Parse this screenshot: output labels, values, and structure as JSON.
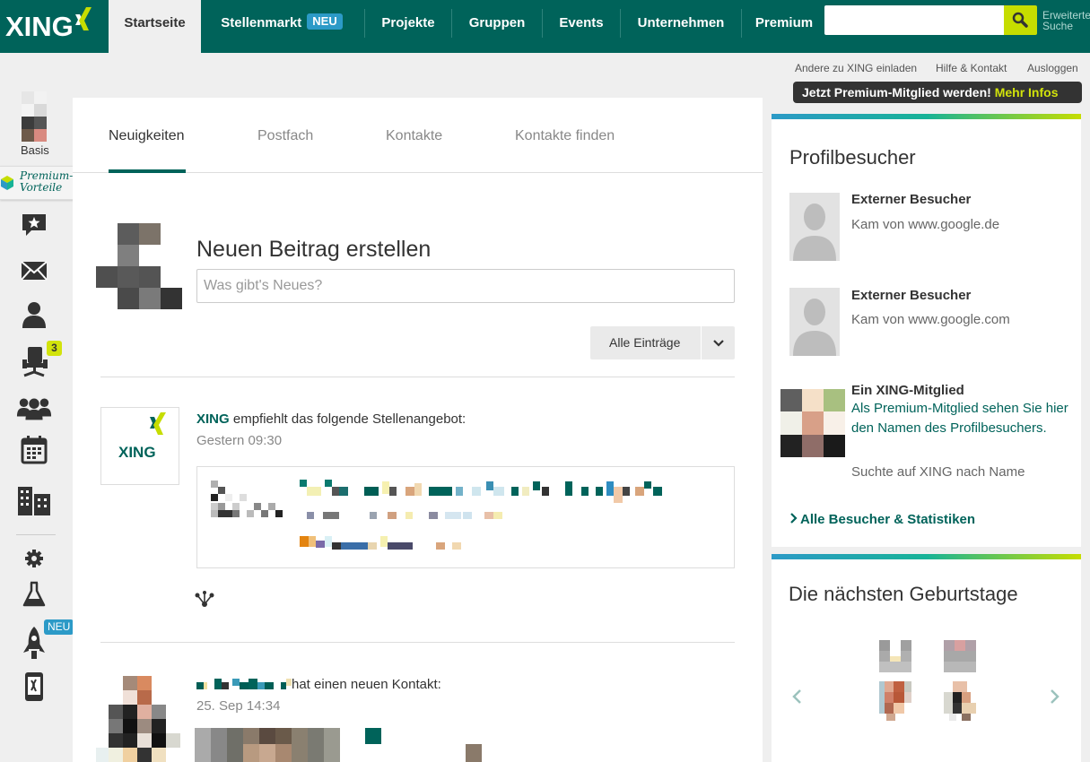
{
  "topnav": {
    "brand": "XING",
    "items": [
      {
        "label": "Startseite",
        "active": true
      },
      {
        "label": "Stellenmarkt",
        "badge": "NEU"
      },
      {
        "label": "Projekte"
      },
      {
        "label": "Gruppen"
      },
      {
        "label": "Events"
      },
      {
        "label": "Unternehmen"
      },
      {
        "label": "Premium"
      }
    ],
    "search": {
      "value": "",
      "placeholder": ""
    },
    "advanced_search": [
      "Erweiterte",
      "Suche"
    ]
  },
  "meta_links": [
    "Andere zu XING einladen",
    "Hilfe & Kontakt",
    "Ausloggen"
  ],
  "premium_banner": {
    "text": "Jetzt Premium-Mitglied werden! ",
    "link": "Mehr Infos"
  },
  "sidebar": {
    "membership": "Basis",
    "premium_label": [
      "Premium-",
      "Vorteile"
    ],
    "jobs_badge": "3",
    "new_badge": "NEU",
    "icons": [
      "star-bubble-icon",
      "envelope-icon",
      "person-icon",
      "office-chair-icon",
      "group-icon",
      "calendar-icon",
      "buildings-icon",
      "gear-icon",
      "flask-icon",
      "rocket-icon",
      "mobile-phone-icon"
    ]
  },
  "main": {
    "tabs": [
      "Neuigkeiten",
      "Postfach",
      "Kontakte",
      "Kontakte finden"
    ],
    "composer": {
      "title": "Neuen Beitrag erstellen",
      "placeholder": "Was gibt's Neues?"
    },
    "filter": {
      "label": "Alle Einträge"
    },
    "feed": [
      {
        "actor": "XING",
        "action": " empfiehlt das folgende Stellenangebot:",
        "time": "Gestern 09:30",
        "logo_text": "XING"
      },
      {
        "action": "hat einen neuen Kontakt:",
        "time": "25. Sep 14:34"
      }
    ]
  },
  "profile_visitors": {
    "title": "Profilbesucher",
    "visitors": [
      {
        "name": "Externer Besucher",
        "detail": "Kam von www.google.de"
      },
      {
        "name": "Externer Besucher",
        "detail": "Kam von www.google.com"
      },
      {
        "name": "Ein XING-Mitglied",
        "link": "Als Premium-Mitglied sehen Sie hier den Namen des Profilbesuchers.",
        "detail": "Suchte auf XING nach Name"
      }
    ],
    "all_link": "Alle Besucher & Statistiken"
  },
  "birthdays": {
    "title": "Die nächsten Geburtstage"
  },
  "colors": {
    "brand": "#00635a",
    "accent": "#c6dd00",
    "link": "#00635a",
    "badge": "#2c9ac7"
  }
}
